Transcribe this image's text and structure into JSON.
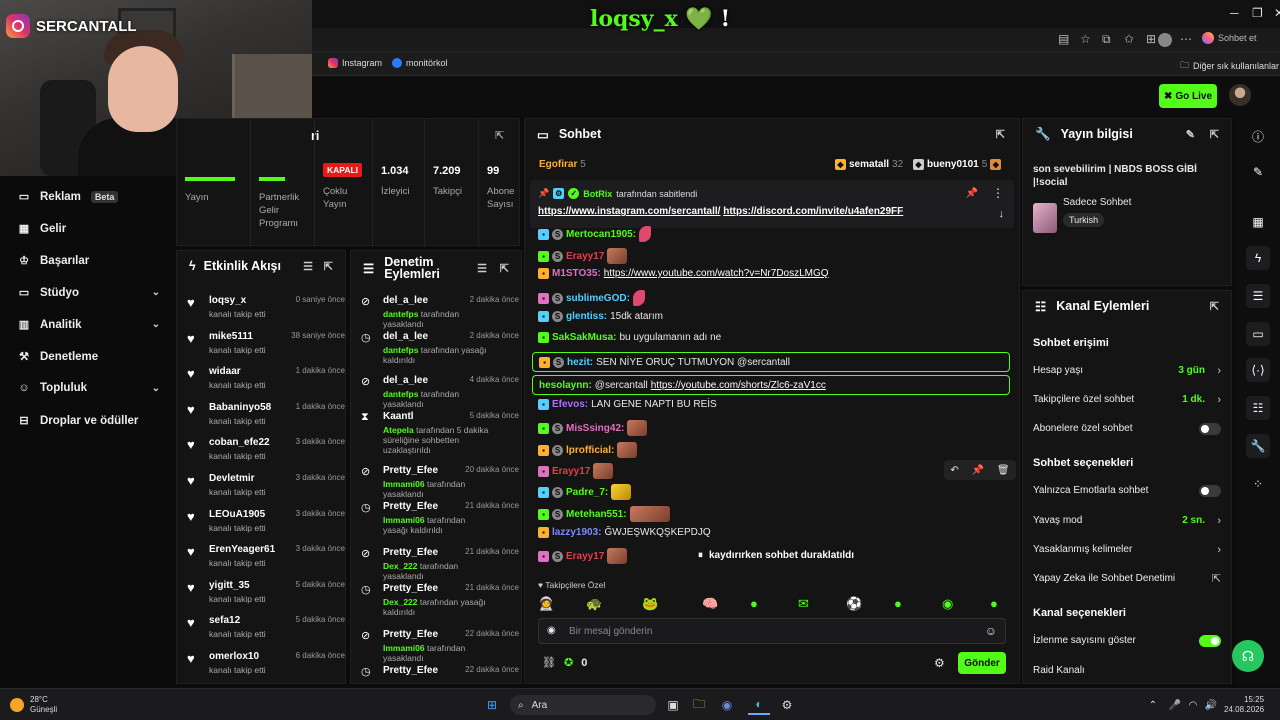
{
  "stream_overlay": {
    "channel_name": "SERCANTALL",
    "title_text": "loqsy_x",
    "heart": "💚",
    "exclaim": "!"
  },
  "browser": {
    "chat_button": "Sohbet et",
    "bookmarks": [
      "Instagram",
      "monitörkol"
    ],
    "other_bookmarks": "Diğer sık kullanılanlar"
  },
  "header": {
    "go_live": "Go Live"
  },
  "sidenav": {
    "items": [
      {
        "label": "Reklam",
        "badge": "Beta"
      },
      {
        "label": "Gelir"
      },
      {
        "label": "Başarılar"
      },
      {
        "label": "Stüdyo"
      },
      {
        "label": "Analitik"
      },
      {
        "label": "Denetleme"
      },
      {
        "label": "Topluluk"
      },
      {
        "label": "Droplar ve ödüller"
      }
    ]
  },
  "stats": {
    "title_fragment": "ri",
    "items": [
      {
        "label": "Yayın",
        "value": ""
      },
      {
        "label": "Partnerlik Gelir Programı",
        "value": ""
      },
      {
        "label": "Çoklu Yayın",
        "badge": "KAPALI"
      },
      {
        "label": "İzleyici",
        "value": "1.034"
      },
      {
        "label": "Takipçi",
        "value": "7.209"
      },
      {
        "label": "Abone Sayısı",
        "value": "99"
      }
    ]
  },
  "activity": {
    "title": "Etkinlik Akışı",
    "items": [
      {
        "name": "loqsy_x",
        "sub": "kanalı takip etti",
        "time": "0 saniye önce"
      },
      {
        "name": "mike5111",
        "sub": "kanalı takip etti",
        "time": "38 saniye önce"
      },
      {
        "name": "widaar",
        "sub": "kanalı takip etti",
        "time": "1 dakika önce"
      },
      {
        "name": "Babaninyo58",
        "sub": "kanalı takip etti",
        "time": "1 dakika önce"
      },
      {
        "name": "coban_efe22",
        "sub": "kanalı takip etti",
        "time": "3 dakika önce"
      },
      {
        "name": "Devletmir",
        "sub": "kanalı takip etti",
        "time": "3 dakika önce"
      },
      {
        "name": "LEOuA1905",
        "sub": "kanalı takip etti",
        "time": "3 dakika önce"
      },
      {
        "name": "ErenYeager61",
        "sub": "kanalı takip etti",
        "time": "3 dakika önce"
      },
      {
        "name": "yigitt_35",
        "sub": "kanalı takip etti",
        "time": "5 dakika önce"
      },
      {
        "name": "sefa12",
        "sub": "kanalı takip etti",
        "time": "5 dakika önce"
      },
      {
        "name": "omerlox10",
        "sub": "kanalı takip etti",
        "time": "6 dakika önce"
      }
    ]
  },
  "moderation": {
    "title": "Denetim Eylemleri",
    "items": [
      {
        "name": "del_a_lee",
        "time": "2 dakika önce",
        "who": "dantefps",
        "sub": " tarafından yasaklandı",
        "icon": "⊘"
      },
      {
        "name": "del_a_lee",
        "time": "2 dakika önce",
        "who": "dantefps",
        "sub": " tarafından yasağı kaldırıldı",
        "icon": "◷"
      },
      {
        "name": "del_a_lee",
        "time": "4 dakika önce",
        "who": "dantefps",
        "sub": " tarafından yasaklandı",
        "icon": "⊘"
      },
      {
        "name": "Kaantl",
        "time": "5 dakika önce",
        "who": "Atepela",
        "sub": " tarafından 5 dakika süreliğine sohbetten uzaklaştırıldı",
        "icon": "⧗"
      },
      {
        "name": "Pretty_Efee",
        "time": "20 dakika önce",
        "who": "Immami06",
        "sub": " tarafından yasaklandı",
        "icon": "⊘"
      },
      {
        "name": "Pretty_Efee",
        "time": "21 dakika önce",
        "who": "Immami06",
        "sub": " tarafından yasağı kaldırıldı",
        "icon": "◷"
      },
      {
        "name": "Pretty_Efee",
        "time": "21 dakika önce",
        "who": "Dex_222",
        "sub": " tarafından yasaklandı",
        "icon": "⊘"
      },
      {
        "name": "Pretty_Efee",
        "time": "21 dakika önce",
        "who": "Dex_222",
        "sub": " tarafından yasağı kaldırıldı",
        "icon": "◷"
      },
      {
        "name": "Pretty_Efee",
        "time": "22 dakika önce",
        "who": "Immami06",
        "sub": " tarafından yasaklandı",
        "icon": "⊘"
      },
      {
        "name": "Pretty_Efee",
        "time": "22 dakika önce",
        "who": "",
        "sub": "",
        "icon": "◷"
      }
    ]
  },
  "chat": {
    "title": "Sohbet",
    "top_gifters": [
      {
        "name": "Egofirar",
        "count": "5"
      },
      {
        "name": "sematall",
        "count": "32"
      },
      {
        "name": "bueny0101",
        "count": "5"
      }
    ],
    "pinned": {
      "by": "BotRix",
      "by_text": "tarafından sabitlendi",
      "link1": "https://www.instagram.com/sercantall/",
      "link2": "https://discord.com/invite/u4afen29FF"
    },
    "messages": [
      {
        "user": "Mertocan1905:",
        "color": "#53fc18",
        "text": "",
        "emote": "pink"
      },
      {
        "user": "Erayy17",
        "color": "#e0404a",
        "text": "",
        "emote": "face"
      },
      {
        "user": "M1STO35:",
        "color": "#e070c0",
        "text": "",
        "link": "https://www.youtube.com/watch?v=Nr7DoszLMGQ"
      },
      {
        "user": "sublimeGOD:",
        "color": "#53d0ff",
        "text": "",
        "emote": "pink"
      },
      {
        "user": "glentiss:",
        "color": "#53d0ff",
        "text": "15dk atarım"
      },
      {
        "user": "SakSakMusa:",
        "color": "#53fc18",
        "text": "bu uygulamanın adı ne"
      },
      {
        "user": "hezit:",
        "color": "#53d0ff",
        "text": "SEN NİYE ORUÇ TUTMUYON @sercantall"
      },
      {
        "user": "hesolaynn:",
        "color": "#53fc18",
        "text": "@sercantall",
        "link": "https://youtube.com/shorts/Zlc6-zaV1cc"
      },
      {
        "user": "Efevos:",
        "color": "#b070ff",
        "text": "LAN GENE NAPTI BU REİS"
      },
      {
        "user": "MisSsing42:",
        "color": "#e070c0",
        "text": "",
        "emote": "face"
      },
      {
        "user": "lprofficial:",
        "color": "#ffb030",
        "text": "",
        "emote": "face"
      },
      {
        "user": "Erayy17",
        "color": "#e0404a",
        "text": "",
        "emote": "face"
      },
      {
        "user": "Padre_7:",
        "color": "#53fc18",
        "text": "",
        "emote": "yellow"
      },
      {
        "user": "Metehan551:",
        "color": "#53fc18",
        "text": "",
        "emote": "wide"
      },
      {
        "user": "lazzy1903:",
        "color": "#7a8cff",
        "text": "ĞWJEŞWKQŞKEPDJQ"
      },
      {
        "user": "Erayy17",
        "color": "#e0404a",
        "text": "",
        "emote": "face"
      }
    ],
    "paused": "kaydırırken sohbet duraklatıldı",
    "followers_only": "Takipçilere Özel",
    "input_placeholder": "Bir mesaj gönderin",
    "points": "0",
    "send": "Gönder"
  },
  "stream_info": {
    "title": "Yayın bilgisi",
    "stream_title": "son sevebilirim | NBDS BOSS GİBİ |!social",
    "category": "Sadece Sohbet",
    "language": "Turkish"
  },
  "channel_actions": {
    "title": "Kanal Eylemleri",
    "chat_access": "Sohbet erişimi",
    "account_age": {
      "label": "Hesap yaşı",
      "value": "3 gün"
    },
    "followers_chat": {
      "label": "Takipçilere özel sohbet",
      "value": "1 dk."
    },
    "subs_chat": {
      "label": "Abonelere özel sohbet"
    },
    "chat_options": "Sohbet seçenekleri",
    "emote_only": {
      "label": "Yalnızca Emotlarla sohbet"
    },
    "slow_mode": {
      "label": "Yavaş mod",
      "value": "2 sn."
    },
    "banned_words": {
      "label": "Yasaklanmış kelimeler"
    },
    "ai_mod": {
      "label": "Yapay Zeka ile Sohbet Denetimi"
    },
    "channel_options": "Kanal seçenekleri",
    "viewer_count": {
      "label": "İzlenme sayısını göster"
    },
    "raid": {
      "label": "Raid Kanalı"
    }
  },
  "taskbar": {
    "weather_temp": "28°C",
    "weather_desc": "Güneşli",
    "search": "Ara",
    "time": "15:25",
    "date": "24.08.2026"
  },
  "colors": {
    "accent": "#53fc18",
    "danger": "#e91916",
    "bg": "#0b0b0c",
    "panel": "#141415"
  }
}
